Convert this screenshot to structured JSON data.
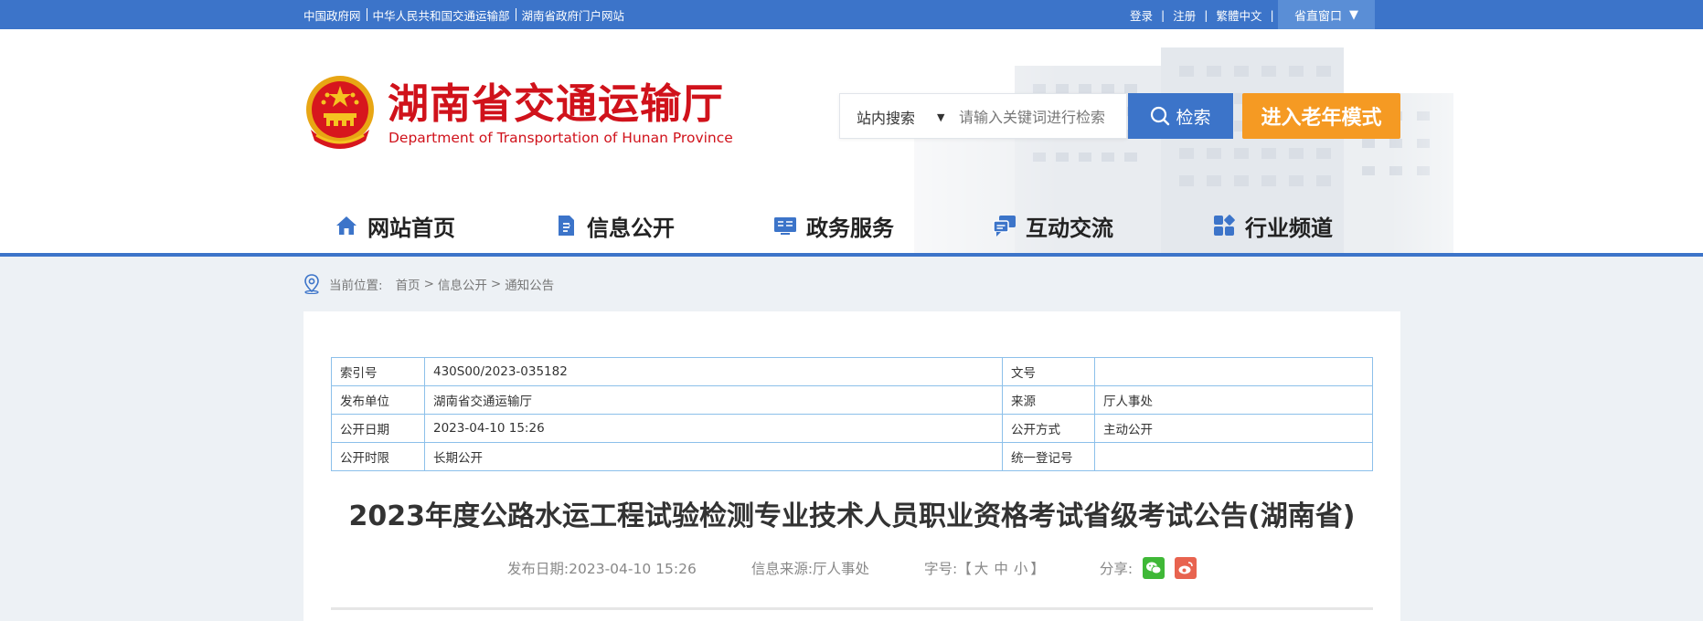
{
  "topbar": {
    "links": [
      "中国政府网",
      "中华人民共和国交通运输部",
      "湖南省政府门户网站"
    ],
    "login": "登录",
    "register": "注册",
    "traditional": "繁體中文",
    "divider": "|",
    "province_window": "省直窗口",
    "province_window_caret": "▼"
  },
  "header": {
    "title": "湖南省交通运输厅",
    "subtitle": "Department of Transportation of Hunan Province"
  },
  "search": {
    "scope": "站内搜索",
    "scope_caret": "▼",
    "placeholder": "请输入关键词进行检索",
    "button": "检索"
  },
  "elder_mode": "进入老年模式",
  "nav": {
    "items": [
      "网站首页",
      "信息公开",
      "政务服务",
      "互动交流",
      "行业频道"
    ]
  },
  "breadcrumb": {
    "label": "当前位置:",
    "items": [
      "首页",
      "信息公开",
      "通知公告"
    ],
    "separator": ">"
  },
  "meta_table": {
    "rows": [
      [
        "索引号",
        "430S00/2023-035182",
        "文号",
        ""
      ],
      [
        "发布单位",
        "湖南省交通运输厅",
        "来源",
        "厅人事处"
      ],
      [
        "公开日期",
        "2023-04-10 15:26",
        "公开方式",
        "主动公开"
      ],
      [
        "公开时限",
        "长期公开",
        "统一登记号",
        ""
      ]
    ]
  },
  "article": {
    "title": "2023年度公路水运工程试验检测专业技术人员职业资格考试省级考试公告(湖南省)",
    "publish_date": "发布日期:2023-04-10 15:26",
    "source": "信息来源:厅人事处",
    "font_size_label": "字号:",
    "bracket_open": "【",
    "font_large": "大",
    "font_medium": "中",
    "font_small": "小",
    "bracket_close": "】",
    "share_label": "分享:"
  },
  "colors": {
    "brand_blue": "#3c74c9",
    "brand_red": "#d0121b",
    "elder_orange": "#f59a23",
    "wechat_green": "#3fb837",
    "weibo_red": "#e8634f"
  }
}
